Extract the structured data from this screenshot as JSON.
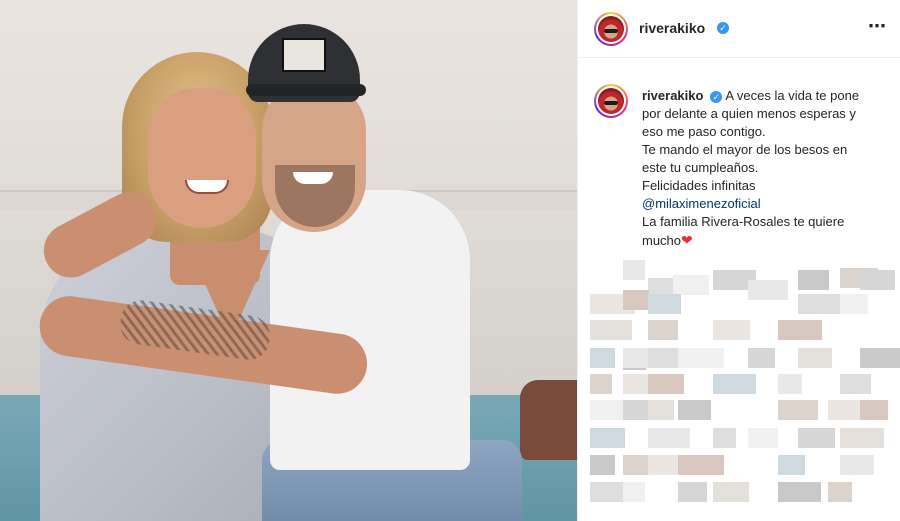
{
  "post": {
    "username": "riverakiko",
    "verified": true,
    "more_icon": "⋯"
  },
  "caption": {
    "username": "riverakiko",
    "lines": [
      "A veces la vida te pone",
      "por delante a quien menos esperas y",
      "eso me paso contigo.",
      "Te mando el mayor de los besos en",
      "este tu cumpleaños.",
      "Felicidades infinitas"
    ],
    "mention": "@milaximenezoficial",
    "closing_line": "La familia Rivera-Rosales te quiere",
    "closing_last_word": "mucho",
    "heart": "❤"
  },
  "colors": {
    "verified": "#3897f0",
    "mention": "#00376b",
    "heart": "#ed2e3a",
    "text": "#262626"
  }
}
